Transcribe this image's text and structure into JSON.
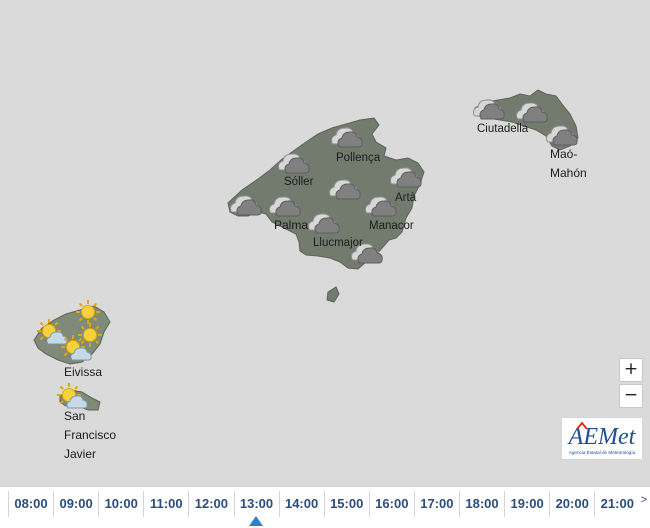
{
  "map": {
    "places": [
      {
        "name": "Pollença"
      },
      {
        "name": "Sóller"
      },
      {
        "name": "Artà"
      },
      {
        "name": "Palma"
      },
      {
        "name": "Manacor"
      },
      {
        "name": "Llucmajor"
      },
      {
        "name": "Ciutadella"
      },
      {
        "name": "Maó-"
      },
      {
        "name": "Mahón"
      },
      {
        "name": "Eivissa"
      },
      {
        "name": "San"
      },
      {
        "name": "Francisco"
      },
      {
        "name": "Javier"
      }
    ],
    "icons": [
      "cloud-icon",
      "partly-sunny-icon",
      "sun-icon"
    ]
  },
  "controls": {
    "zoom_in": "+",
    "zoom_out": "−"
  },
  "logo": {
    "name": "AEMet",
    "tagline": "Agencia Estatal de Meteorología"
  },
  "timeline": {
    "hours": [
      "08:00",
      "09:00",
      "10:00",
      "11:00",
      "12:00",
      "13:00",
      "14:00",
      "15:00",
      "16:00",
      "17:00",
      "18:00",
      "19:00",
      "20:00",
      "21:00"
    ],
    "selected": "13:00",
    "next_label": ">"
  },
  "colors": {
    "land": "#737b6e",
    "sea": "#dadada",
    "accent": "#2f7fd0",
    "hour_text": "#2b4c7e"
  }
}
